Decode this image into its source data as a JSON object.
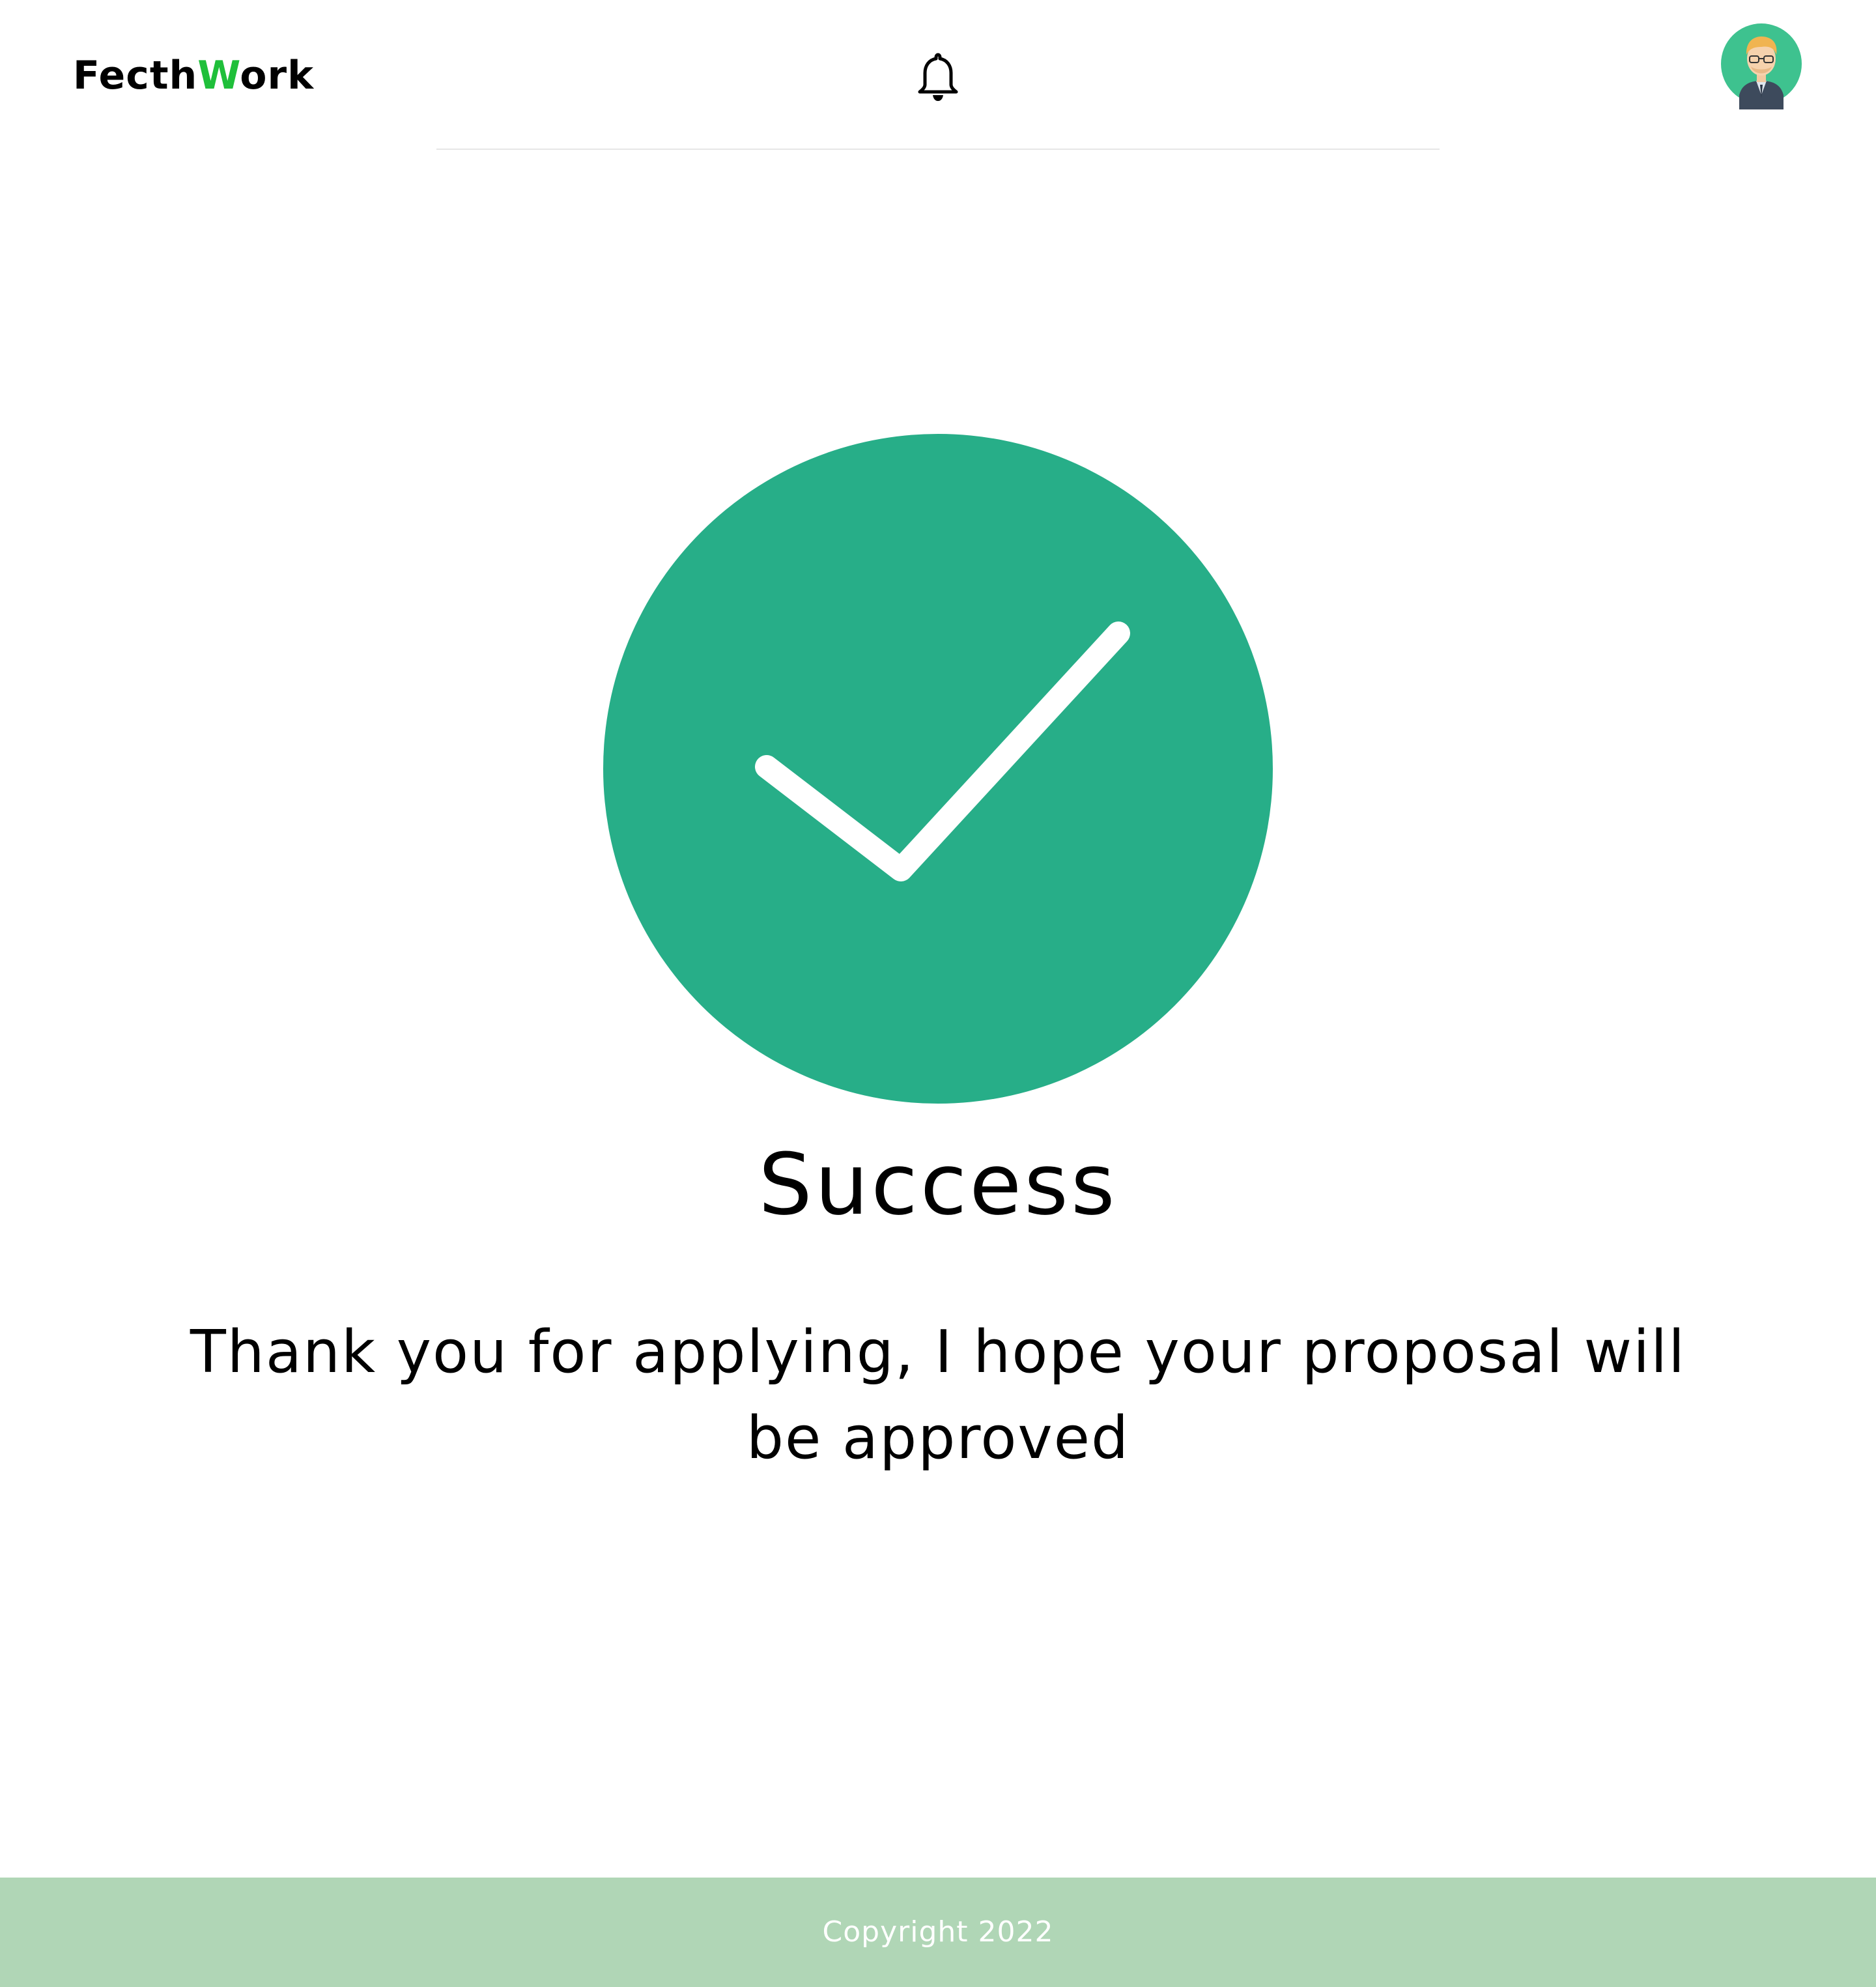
{
  "header": {
    "logo_prefix": "Fecth",
    "logo_highlight": "W",
    "logo_suffix": "ork",
    "logo_accent_color": "#1fbf3a",
    "notification_icon": "bell-icon",
    "avatar_icon": "user-avatar"
  },
  "main": {
    "status_icon": "check-circle-icon",
    "status_color": "#27ae88",
    "title": "Success",
    "message": "Thank you for applying, I hope your proposal will be approved"
  },
  "footer": {
    "copyright": "Copyright 2022",
    "background_color": "#b0d6b6"
  }
}
